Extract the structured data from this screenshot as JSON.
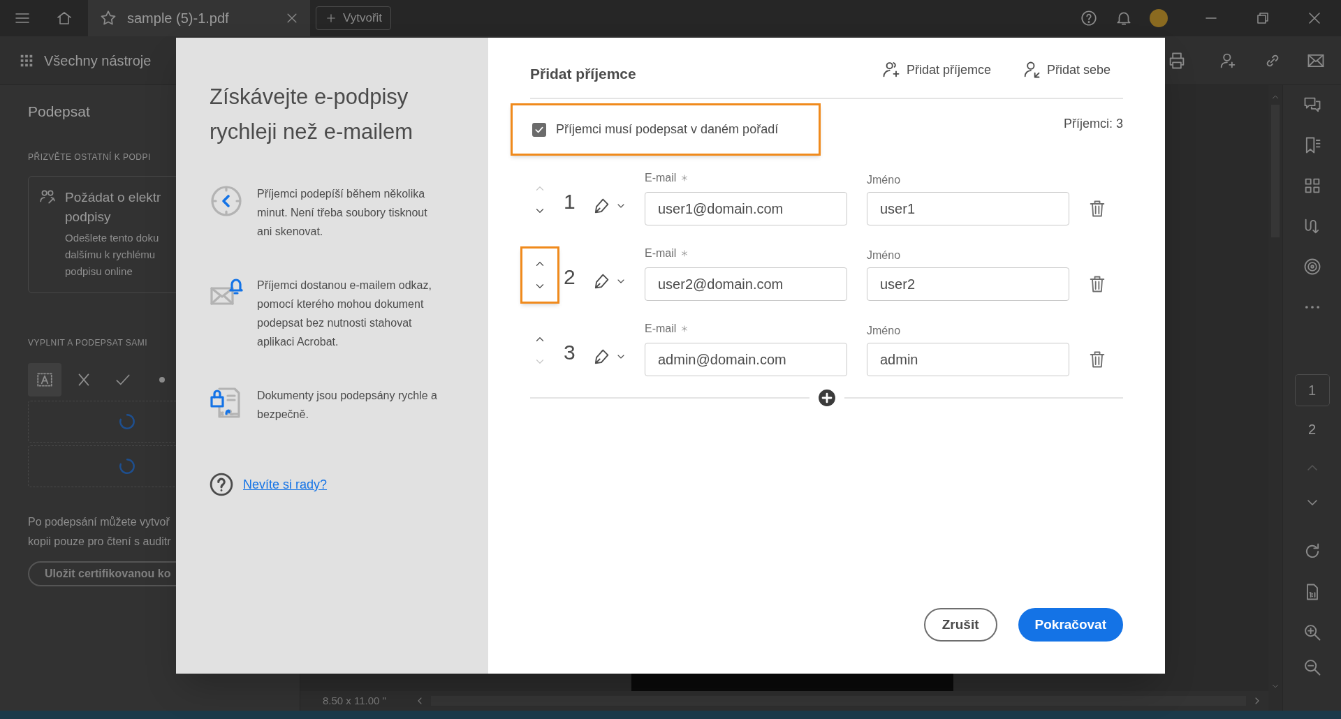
{
  "app_bar": {
    "tab_title": "sample (5)-1.pdf",
    "new_button": "Vytvořit"
  },
  "toolbar": {
    "all_tools": "Všechny nástroje"
  },
  "side_panel": {
    "title": "Podepsat",
    "invite_heading": "PŘIZVĚTE OSTATNÍ K PODPI",
    "request_card": {
      "title_lines": [
        "Požádat o elektr",
        "podpisy"
      ],
      "description_lines": [
        "Odešlete tento doku",
        "dalšímu k rychlému",
        "podpisu online"
      ]
    },
    "fill_heading": "VYPLNIT A PODEPSAT SAMI",
    "tools": [
      {
        "kind": "text",
        "selected": true
      },
      {
        "kind": "cross",
        "selected": false
      },
      {
        "kind": "check",
        "selected": false
      },
      {
        "kind": "dot",
        "selected": false
      }
    ],
    "signature_slots": [
      {
        "kind": "loading"
      },
      {
        "kind": "loading"
      }
    ],
    "note_lines": [
      "Po podepsání můžete vytvoř",
      "kopii pouze pro čtení s auditr"
    ],
    "certify_button": "Uložit certifikovanou ko"
  },
  "status_bar": {
    "page_size": "8.50 x 11.00 \""
  },
  "page_nav": {
    "pages": [
      {
        "label": "1",
        "selected": true
      },
      {
        "label": "2",
        "selected": false
      }
    ]
  },
  "dialog": {
    "promo": {
      "heading": "Získávejte e-podpisy rychleji než e-mailem",
      "features": [
        {
          "kind": "clock",
          "text": "Příjemci podepíší během několika minut. Není třeba soubory tisknout ani skenovat."
        },
        {
          "kind": "mail",
          "text": "Příjemci dostanou e-mailem odkaz, pomocí kterého mohou dokument podepsat bez nutnosti stahovat aplikaci Acrobat."
        },
        {
          "kind": "secure",
          "text": "Dokumenty jsou podepsány rychle a bezpečně."
        }
      ],
      "help_link": "Nevíte si rady?"
    },
    "title": "Přidat příjemce",
    "add_recipient": "Přidat příjemce",
    "add_self": "Přidat sebe",
    "order_checkbox": {
      "label": "Příjemci musí podepsat v daném pořadí",
      "checked": true,
      "highlighted": true
    },
    "count": "Příjemci: 3",
    "recipients": [
      {
        "number": "1",
        "email_label": "E-mail",
        "email_required": true,
        "email": "user1@domain.com",
        "name_label": "Jméno",
        "name": "user1",
        "up_enabled": false,
        "down_enabled": true,
        "arrows_highlighted": false
      },
      {
        "number": "2",
        "email_label": "E-mail",
        "email_required": true,
        "email": "user2@domain.com",
        "name_label": "Jméno",
        "name": "user2",
        "up_enabled": true,
        "down_enabled": true,
        "arrows_highlighted": true
      },
      {
        "number": "3",
        "email_label": "E-mail",
        "email_required": true,
        "email": "admin@domain.com",
        "name_label": "Jméno",
        "name": "admin",
        "up_enabled": true,
        "down_enabled": false,
        "arrows_highlighted": false
      }
    ],
    "cancel": "Zrušit",
    "continue": "Pokračovat"
  }
}
